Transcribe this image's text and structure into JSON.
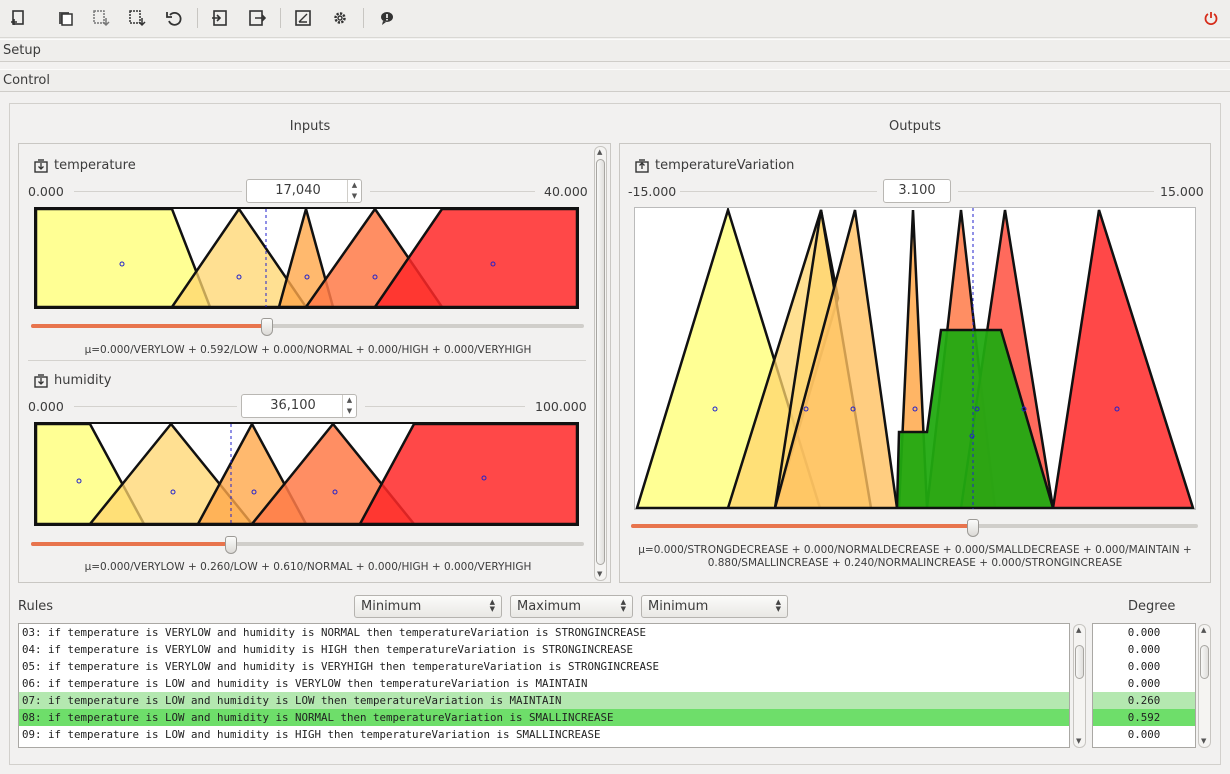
{
  "toolbar": {
    "buttons": [
      {
        "name": "new-engine-icon"
      },
      {
        "name": "open-copy-icon"
      },
      {
        "name": "import-icon"
      },
      {
        "name": "export-icon"
      },
      {
        "name": "undo-icon"
      },
      {
        "name": "login-icon"
      },
      {
        "name": "logout-icon"
      },
      {
        "name": "chart-icon"
      },
      {
        "name": "gear-icon"
      },
      {
        "name": "info-bubble-icon"
      },
      {
        "name": "power-icon"
      }
    ]
  },
  "sections": {
    "setup": "Setup",
    "control": "Control"
  },
  "inputs_title": "Inputs",
  "outputs_title": "Outputs",
  "variables": {
    "temperature": {
      "name": "temperature",
      "min": "0.000",
      "max": "40.000",
      "value": "17,040",
      "slider_fraction": 0.426,
      "mu": "μ=0.000/VERYLOW + 0.592/LOW + 0.000/NORMAL + 0.000/HIGH + 0.000/VERYHIGH"
    },
    "humidity": {
      "name": "humidity",
      "min": "0.000",
      "max": "100.000",
      "value": "36,100",
      "slider_fraction": 0.361,
      "mu": "μ=0.000/VERYLOW + 0.260/LOW + 0.610/NORMAL + 0.000/HIGH + 0.000/VERYHIGH"
    },
    "temperatureVariation": {
      "name": "temperatureVariation",
      "min": "-15.000",
      "max": "15.000",
      "value": "3.100",
      "slider_fraction": 0.603,
      "mu_line1": "μ=0.000/STRONGDECREASE + 0.000/NORMALDECREASE + 0.000/SMALLDECREASE + 0.000/MAINTAIN +",
      "mu_line2": "0.880/SMALLINCREASE + 0.240/NORMALINCREASE + 0.000/STRONGINCREASE"
    }
  },
  "rules": {
    "label": "Rules",
    "degree_label": "Degree",
    "conjunction": "Minimum",
    "disjunction": "Maximum",
    "implication": "Minimum",
    "items": [
      {
        "text": "03: if temperature is VERYLOW and humidity is NORMAL then temperatureVariation is STRONGINCREASE",
        "degree": "0.000",
        "state": ""
      },
      {
        "text": "04: if temperature is VERYLOW and humidity is HIGH then temperatureVariation is STRONGINCREASE",
        "degree": "0.000",
        "state": ""
      },
      {
        "text": "05: if temperature is VERYLOW and humidity is VERYHIGH then temperatureVariation is STRONGINCREASE",
        "degree": "0.000",
        "state": ""
      },
      {
        "text": "06: if temperature is LOW and humidity is VERYLOW then temperatureVariation is MAINTAIN",
        "degree": "0.000",
        "state": ""
      },
      {
        "text": "07: if temperature is LOW and humidity is LOW then temperatureVariation is MAINTAIN",
        "degree": "0.260",
        "state": "light"
      },
      {
        "text": "08: if temperature is LOW and humidity is NORMAL then temperatureVariation is SMALLINCREASE",
        "degree": "0.592",
        "state": "strong"
      },
      {
        "text": "09: if temperature is LOW and humidity is HIGH then temperatureVariation is SMALLINCREASE",
        "degree": "0.000",
        "state": ""
      }
    ]
  },
  "colors": {
    "verylow": "#ffff99",
    "low": "#ffd980",
    "normal": "#ffb060",
    "high": "#ff7f50",
    "veryhigh": "#ff3030",
    "activated": "#22aa11",
    "slider": "#e8744d"
  }
}
